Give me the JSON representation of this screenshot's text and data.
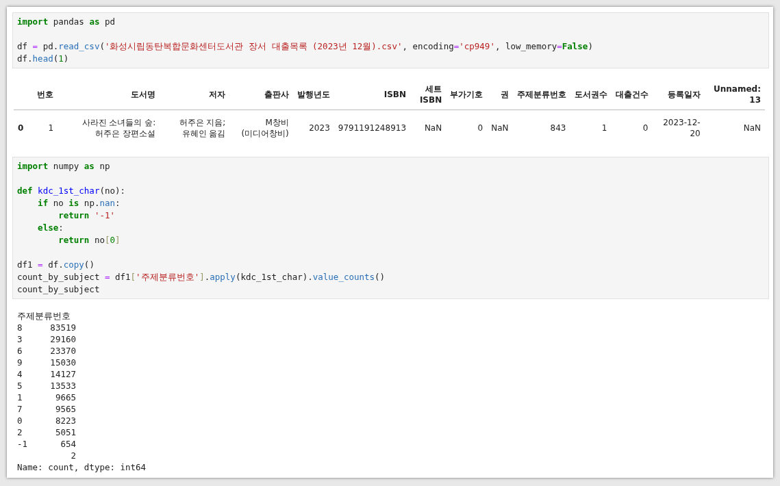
{
  "cells": [
    {
      "kind": "code",
      "blocks": [
        [
          [
            {
              "t": "import ",
              "kind": "keyword"
            },
            {
              "t": "pandas ",
              "kind": "plain"
            },
            {
              "t": "as",
              "kind": "keyword"
            },
            {
              "t": " pd",
              "kind": "plain"
            }
          ]
        ],
        [
          [
            {
              "t": "df ",
              "kind": "plain"
            },
            {
              "t": "=",
              "kind": "operator"
            },
            {
              "t": " pd.",
              "kind": "plain"
            },
            {
              "t": "read_csv",
              "kind": "attribute"
            },
            {
              "t": "(",
              "kind": "plain"
            },
            {
              "t": "'화성시립동탄복합문화센터도서관 장서 대출목록 (2023년 12월).csv'",
              "kind": "string"
            },
            {
              "t": ", encoding",
              "kind": "plain"
            },
            {
              "t": "=",
              "kind": "operator"
            },
            {
              "t": "'cp949'",
              "kind": "string"
            },
            {
              "t": ", low_memory",
              "kind": "plain"
            },
            {
              "t": "=",
              "kind": "operator"
            },
            {
              "t": "False",
              "kind": "keyword"
            },
            {
              "t": ")",
              "kind": "plain"
            }
          ],
          [
            {
              "t": "df.",
              "kind": "plain"
            },
            {
              "t": "head",
              "kind": "attribute"
            },
            {
              "t": "(",
              "kind": "plain"
            },
            {
              "t": "1",
              "kind": "number"
            },
            {
              "t": ")",
              "kind": "plain"
            }
          ]
        ]
      ]
    },
    {
      "kind": "table",
      "columns": [
        "번호",
        "도서명",
        "저자",
        "출판사",
        "발행년도",
        "ISBN",
        "세트 ISBN",
        "부가기호",
        "권",
        "주제분류번호",
        "도서권수",
        "대출건수",
        "등록일자",
        "Unnamed: 13"
      ],
      "rows": [
        {
          "index": "0",
          "cells": [
            "1",
            "사라진 소녀들의 숲: 허주은 장편소설",
            "허주은 지음;유혜인 옮김",
            "M창비(미디어창비)",
            "2023",
            "9791191248913",
            "NaN",
            "0",
            "NaN",
            "843",
            "1",
            "0",
            "2023-12-20",
            "NaN"
          ]
        }
      ]
    },
    {
      "kind": "code",
      "blocks": [
        [
          [
            {
              "t": "import ",
              "kind": "keyword"
            },
            {
              "t": "numpy ",
              "kind": "plain"
            },
            {
              "t": "as",
              "kind": "keyword"
            },
            {
              "t": " np",
              "kind": "plain"
            }
          ]
        ],
        [
          [
            {
              "t": "def ",
              "kind": "keyword"
            },
            {
              "t": "kdc_1st_char",
              "kind": "function"
            },
            {
              "t": "(no):",
              "kind": "plain"
            }
          ],
          [
            {
              "t": "    if",
              "kind": "keyword"
            },
            {
              "t": " no ",
              "kind": "plain"
            },
            {
              "t": "is",
              "kind": "keyword"
            },
            {
              "t": " np.",
              "kind": "plain"
            },
            {
              "t": "nan",
              "kind": "attribute"
            },
            {
              "t": ":",
              "kind": "plain"
            }
          ],
          [
            {
              "t": "        return ",
              "kind": "keyword"
            },
            {
              "t": "'-1'",
              "kind": "string"
            }
          ],
          [
            {
              "t": "    else",
              "kind": "keyword"
            },
            {
              "t": ":",
              "kind": "plain"
            }
          ],
          [
            {
              "t": "        return",
              "kind": "keyword"
            },
            {
              "t": " no",
              "kind": "plain"
            },
            {
              "t": "[",
              "kind": "bracket"
            },
            {
              "t": "0",
              "kind": "number"
            },
            {
              "t": "]",
              "kind": "bracket"
            }
          ]
        ],
        [
          [
            {
              "t": "df1 ",
              "kind": "plain"
            },
            {
              "t": "=",
              "kind": "operator"
            },
            {
              "t": " df.",
              "kind": "plain"
            },
            {
              "t": "copy",
              "kind": "attribute"
            },
            {
              "t": "()",
              "kind": "plain"
            }
          ],
          [
            {
              "t": "count_by_subject ",
              "kind": "plain"
            },
            {
              "t": "=",
              "kind": "operator"
            },
            {
              "t": " df1",
              "kind": "plain"
            },
            {
              "t": "[",
              "kind": "bracket"
            },
            {
              "t": "'주제분류번호'",
              "kind": "string"
            },
            {
              "t": "]",
              "kind": "bracket"
            },
            {
              "t": ".",
              "kind": "plain"
            },
            {
              "t": "apply",
              "kind": "attribute"
            },
            {
              "t": "(kdc_1st_char).",
              "kind": "plain"
            },
            {
              "t": "value_counts",
              "kind": "attribute"
            },
            {
              "t": "()",
              "kind": "plain"
            }
          ],
          [
            {
              "t": "count_by_subject",
              "kind": "plain"
            }
          ]
        ]
      ]
    },
    {
      "kind": "series",
      "header": "주제분류번호",
      "rows": [
        {
          "index": "8",
          "value": "83519"
        },
        {
          "index": "3",
          "value": "29160"
        },
        {
          "index": "6",
          "value": "23370"
        },
        {
          "index": "9",
          "value": "15030"
        },
        {
          "index": "4",
          "value": "14127"
        },
        {
          "index": "5",
          "value": "13533"
        },
        {
          "index": "1",
          "value": "9665"
        },
        {
          "index": "7",
          "value": "9565"
        },
        {
          "index": "0",
          "value": "8223"
        },
        {
          "index": "2",
          "value": "5051"
        },
        {
          "index": "-1",
          "value": "654"
        },
        {
          "value": "2"
        }
      ],
      "footer": "Name: count, dtype: int64"
    }
  ]
}
